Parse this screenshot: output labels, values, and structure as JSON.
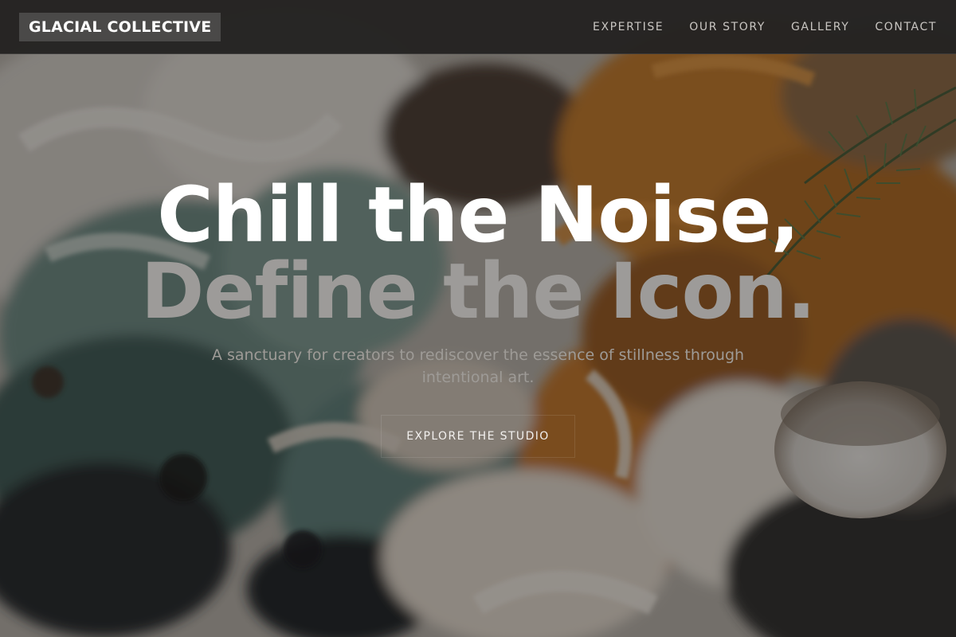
{
  "nav": {
    "logo": "GLACIAL COLLECTIVE",
    "links": [
      {
        "label": "EXPERTISE"
      },
      {
        "label": "OUR STORY"
      },
      {
        "label": "GALLERY"
      },
      {
        "label": "CONTACT"
      }
    ]
  },
  "hero": {
    "headline_line1": "Chill the Noise,",
    "headline_line2": "Define the Icon.",
    "subtitle": "A sanctuary for creators to rediscover the essence of stillness through intentional art.",
    "cta_label": "EXPLORE THE STUDIO"
  },
  "colors": {
    "navbar": "#242322",
    "logo_bg": "#4a4948",
    "headline_primary": "#ffffff",
    "headline_secondary": "#9d9b99",
    "subtitle": "#9e9b97"
  }
}
